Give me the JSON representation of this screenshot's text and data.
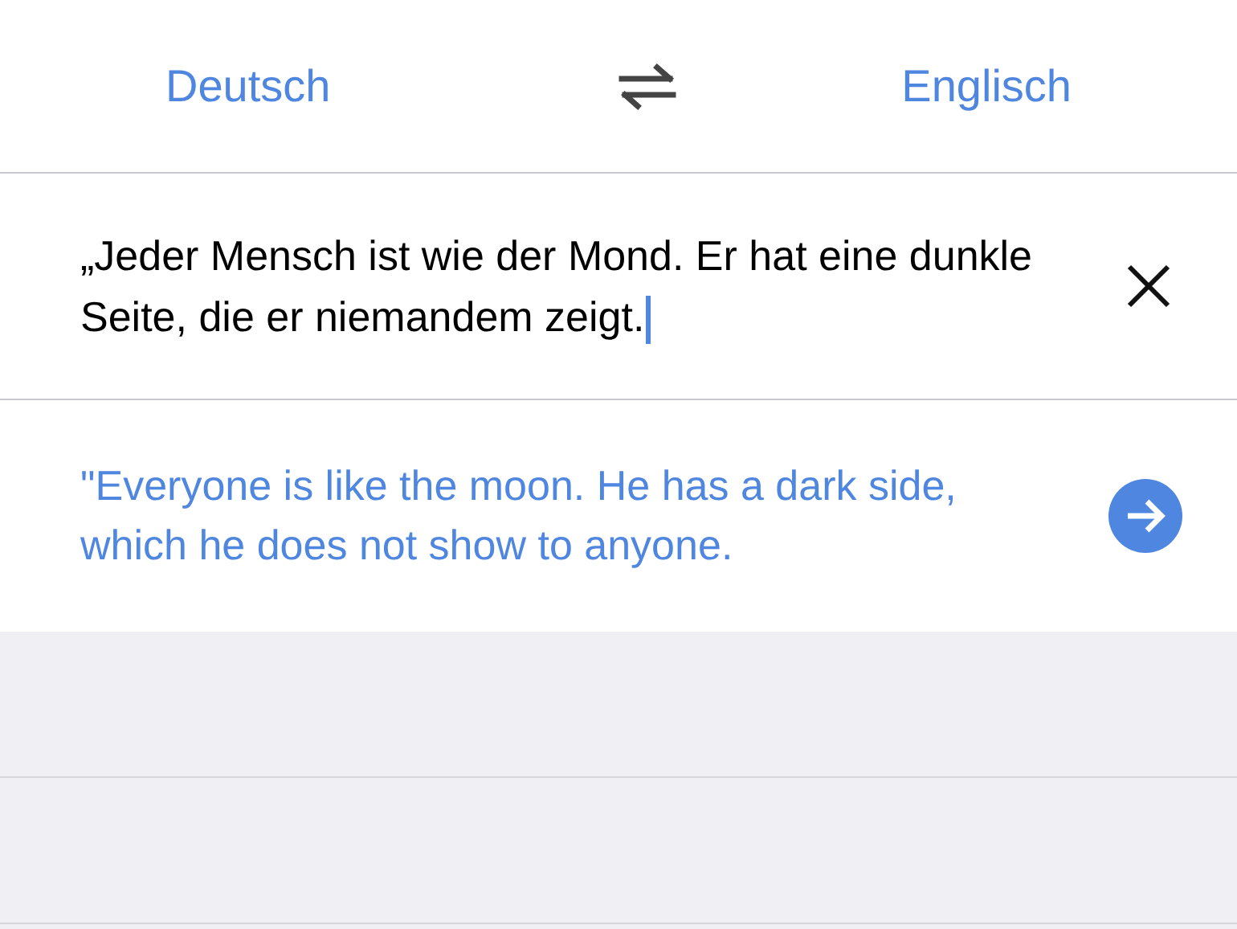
{
  "header": {
    "source_language": "Deutsch",
    "target_language": "Englisch"
  },
  "input": {
    "value": "„Jeder Mensch ist wie der Mond. Er hat eine dunkle Seite, die er niemandem zeigt.",
    "focused": true
  },
  "translation": {
    "text": "\"Everyone is like the moon. He has a dark side, which he does not show to anyone."
  }
}
